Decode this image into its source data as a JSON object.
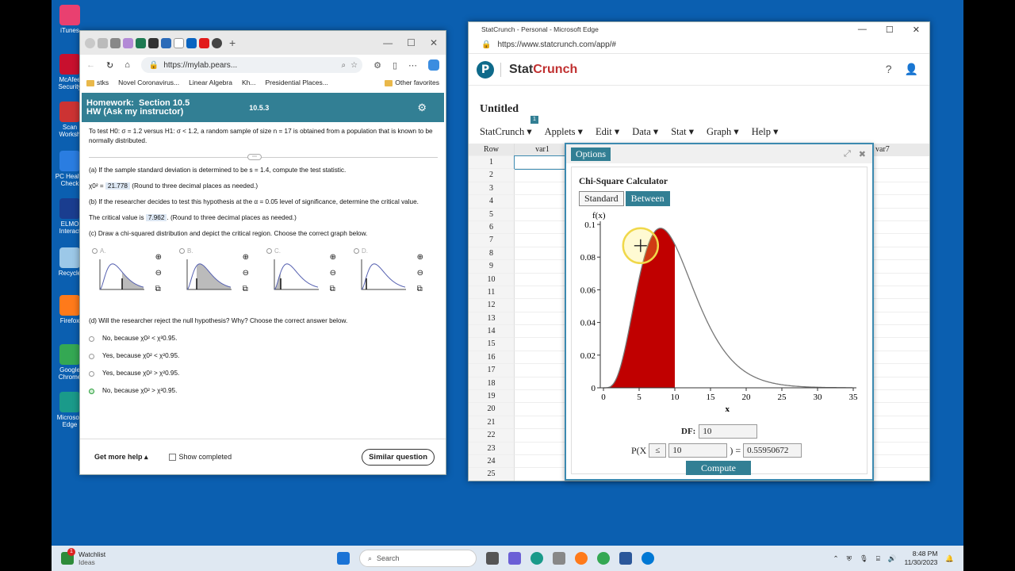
{
  "desktop": {
    "icons": [
      {
        "label": "iTunes",
        "color": "#e94070"
      },
      {
        "label": "McAfee Security",
        "color": "#c8102e"
      },
      {
        "label": "Scan Worksh",
        "color": "#cc3333"
      },
      {
        "label": "PC Health Check",
        "color": "#2a7de1"
      },
      {
        "label": "ELMO Interact",
        "color": "#1a3d8f"
      },
      {
        "label": "Recycle",
        "color": "#9cc8e8"
      },
      {
        "label": "Firefox",
        "color": "#ff7a1a"
      },
      {
        "label": "Google Chrome",
        "color": "#34a853"
      },
      {
        "label": "Microsoft Edge",
        "color": "#1a9a8a"
      }
    ]
  },
  "left_browser": {
    "tabs": [
      "Ju",
      "N",
      "C",
      "D",
      "A",
      "S"
    ],
    "url": "https://mylab.pears...",
    "favorites": [
      "stks",
      "Novel Coronavirus...",
      "Linear Algebra",
      "Kh...",
      "Presidential Places..."
    ],
    "other_favorites": "Other favorites",
    "homework": {
      "label": "Homework:",
      "section": "Section 10.5",
      "subtitle": "HW (Ask my instructor)",
      "number": "10.5.3"
    },
    "problem": "To test H0: σ = 1.2 versus H1: σ < 1.2, a random sample of size n = 17 is obtained from a population that is known to be normally distributed.",
    "part_a": "(a) If the sample standard deviation is determined to be s = 1.4, compute the test statistic.",
    "part_a_answer_prefix": "χ0² =",
    "part_a_answer": "21.778",
    "part_a_hint": "(Round to three decimal places as needed.)",
    "part_b": "(b) If the researcher decides to test this hypothesis at the α = 0.05 level of significance, determine the critical value.",
    "part_b_prefix": "The critical value is",
    "part_b_answer": "7.962",
    "part_b_hint": ". (Round to three decimal places as needed.)",
    "part_c": "(c) Draw a chi-squared distribution and depict the critical region. Choose the correct graph below.",
    "graph_options": [
      "A.",
      "B.",
      "C.",
      "D."
    ],
    "part_d": "(d) Will the researcher reject the null hypothesis? Why? Choose the correct answer below.",
    "choices": [
      "No, because χ0² < χ²0.95.",
      "Yes, because χ0² < χ²0.95.",
      "Yes, because χ0² > χ²0.95.",
      "No, because χ0² > χ²0.95."
    ],
    "footer": {
      "help": "Get more help ▴",
      "show_completed": "Show completed",
      "similar": "Similar question"
    }
  },
  "right_browser": {
    "title": "StatCrunch - Personal - Microsoft Edge",
    "url": "https://www.statcrunch.com/app/#",
    "brand_a": "Stat",
    "brand_b": "Crunch",
    "doc_title": "Untitled",
    "badge": "1",
    "menu": [
      "StatCrunch ▾",
      "Applets ▾",
      "Edit ▾",
      "Data ▾",
      "Stat ▾",
      "Graph ▾",
      "Help ▾"
    ],
    "grid": {
      "row_header": "Row",
      "col_first": "var1",
      "col_last": "var7",
      "rows": [
        "1",
        "2",
        "3",
        "4",
        "5",
        "6",
        "7",
        "8",
        "9",
        "10",
        "11",
        "12",
        "13",
        "14",
        "15",
        "16",
        "17",
        "18",
        "19",
        "20",
        "21",
        "22",
        "23",
        "24",
        "25"
      ]
    }
  },
  "dialog": {
    "options": "Options",
    "title": "Chi-Square Calculator",
    "tab_standard": "Standard",
    "tab_between": "Between",
    "df_label": "DF:",
    "df_value": "10",
    "p_prefix": "P(X",
    "operator": "≤",
    "x_value": "10",
    "p_suffix": ") =",
    "p_value": "0.55950672",
    "compute": "Compute"
  },
  "chart_data": {
    "type": "area",
    "title": "",
    "xlabel": "x",
    "ylabel": "f(x)",
    "df": 10,
    "shaded_upper": 10,
    "xlim": [
      0,
      35
    ],
    "ylim": [
      0,
      0.1
    ],
    "x_ticks": [
      0,
      5,
      10,
      15,
      20,
      25,
      30,
      35
    ],
    "y_ticks": [
      0,
      0.02,
      0.04,
      0.06,
      0.08,
      0.1
    ],
    "y_tick_labels": [
      "0",
      "0.02",
      "0.04",
      "0.06",
      "0.08",
      "0.1"
    ],
    "shade_color": "#c00000",
    "curve_color": "#777777"
  },
  "taskbar": {
    "widget_title": "Watchlist",
    "widget_sub": "Ideas",
    "widget_badge": "1",
    "search": "Search",
    "time": "8:48 PM",
    "date": "11/30/2023"
  }
}
